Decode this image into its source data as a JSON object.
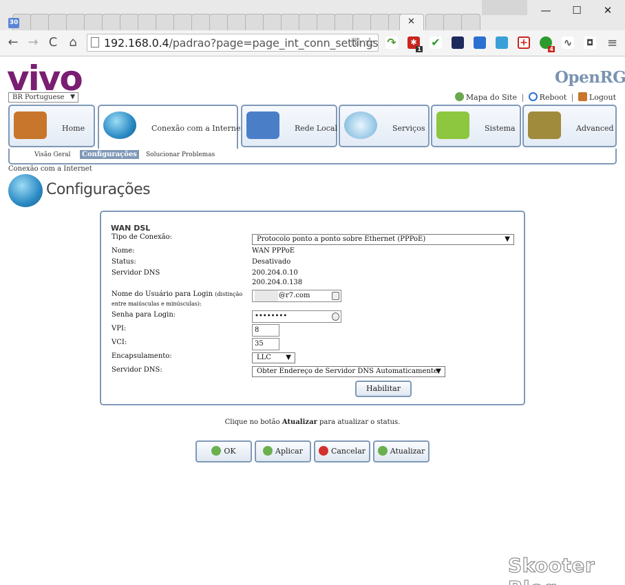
{
  "browser": {
    "tab_badge": "30",
    "tab_close": "✕",
    "window": {
      "minimize": "—",
      "maximize": "☐",
      "close": "✕"
    },
    "nav": {
      "back": "←",
      "forward": "→",
      "reload": "C",
      "home": "⌂"
    },
    "url_host": "192.168.0.4",
    "url_path": "/padrao?page=page_int_conn_settings",
    "key_icon": "⚿",
    "star_icon": "☆",
    "ext_badges": {
      "lastpass": "1",
      "ext2": "4"
    },
    "menu_icon": "≡"
  },
  "header": {
    "brand": "vivo",
    "vendor": "OpenRG",
    "language": {
      "value": "BR Portuguese",
      "arrow": "▼"
    },
    "links": {
      "sitemap": "Mapa do Site",
      "reboot": "Reboot",
      "logout": "Logout",
      "sep": "|"
    }
  },
  "nav": {
    "tabs": [
      {
        "label": "Home",
        "color": "#c8762b"
      },
      {
        "label": "Conexão com a Internet",
        "color": "#3d9ad1"
      },
      {
        "label": "Rede Local",
        "color": "#4a7fc8"
      },
      {
        "label": "Serviços",
        "color": "#6fb0d8"
      },
      {
        "label": "Sistema",
        "color": "#8dc63f"
      },
      {
        "label": "Advanced",
        "color": "#a08a3c"
      }
    ],
    "sub": [
      {
        "label": "Visão Geral"
      },
      {
        "label": "Configurações"
      },
      {
        "label": "Solucionar Problemas"
      }
    ]
  },
  "breadcrumb": "Conexão com a Internet",
  "page_title": "Configurações",
  "form": {
    "title": "WAN DSL",
    "conn_type": {
      "label": "Tipo de Conexão:",
      "value": "Protocolo ponto a ponto sobre Ethernet (PPPoE)",
      "arrow": "▼"
    },
    "name": {
      "label": "Nome:",
      "value": "WAN PPPoE"
    },
    "status": {
      "label": "Status:",
      "value": "Desativado"
    },
    "dns_servers": {
      "label": "Servidor DNS",
      "values": [
        "200.204.0.10",
        "200.204.0.138"
      ]
    },
    "username": {
      "label": "Nome do Usuário para Login",
      "note": "(distinção",
      "note2": "entre maiúsculas e minúsculas):",
      "value": "@r7.com"
    },
    "password": {
      "label": "Senha para Login:",
      "value": "••••••••"
    },
    "vpi": {
      "label": "VPI:",
      "value": "8"
    },
    "vci": {
      "label": "VCI:",
      "value": "35"
    },
    "encap": {
      "label": "Encapsulamento:",
      "value": "LLC",
      "arrow": "▼"
    },
    "dns_mode": {
      "label": "Servidor DNS:",
      "value": "Obter Endereço de Servidor DNS Automaticamente",
      "arrow": "▼"
    },
    "enable_button": "Habilitar"
  },
  "status_note": {
    "before": "Clique no botão",
    "bold": "Atualizar",
    "after": "para atualizar o status."
  },
  "buttons": {
    "ok": "OK",
    "apply": "Aplicar",
    "cancel": "Cancelar",
    "refresh": "Atualizar"
  },
  "watermark": "Skooter Blog"
}
